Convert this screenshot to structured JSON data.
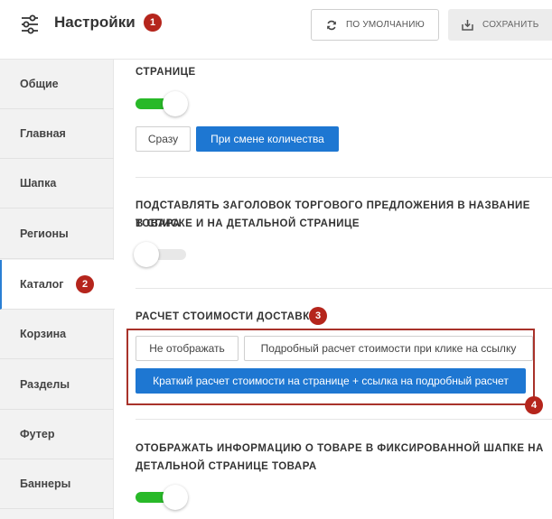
{
  "header": {
    "title": "Настройки",
    "badge": "1",
    "default_label": "ПО УМОЛЧАНИЮ",
    "save_label": "СОХРАНИТЬ"
  },
  "sidebar": {
    "items": [
      {
        "label": "Общие"
      },
      {
        "label": "Главная"
      },
      {
        "label": "Шапка"
      },
      {
        "label": "Регионы"
      },
      {
        "label": "Каталог"
      },
      {
        "label": "Корзина"
      },
      {
        "label": "Разделы"
      },
      {
        "label": "Футер"
      },
      {
        "label": "Баннеры"
      }
    ],
    "active_index": 4,
    "badge": "2"
  },
  "main": {
    "section1": {
      "title_tail": "СТРАНИЦЕ",
      "toggle": "on",
      "options": [
        "Сразу",
        "При смене количества"
      ],
      "selected": "При смене количества"
    },
    "section2": {
      "title_line1": "ПОДСТАВЛЯТЬ ЗАГОЛОВОК ТОРГОВОГО ПРЕДЛОЖЕНИЯ В НАЗВАНИЕ ТОВАРА",
      "title_line2": "В СПИСКЕ И НА ДЕТАЛЬНОЙ СТРАНИЦЕ",
      "toggle": "off"
    },
    "section3": {
      "title": "РАСЧЕТ СТОИМОСТИ ДОСТАВКИ",
      "badge_title": "3",
      "badge_box": "4",
      "options": [
        "Не отображать",
        "Подробный расчет стоимости при клике на ссылку",
        "Краткий расчет стоимости на странице + ссылка на подробный расчет"
      ],
      "selected": "Краткий расчет стоимости на странице + ссылка на подробный расчет"
    },
    "section4": {
      "title_line1": "ОТОБРАЖАТЬ ИНФОРМАЦИЮ О ТОВАРЕ В ФИКСИРОВАННОЙ ШАПКЕ НА",
      "title_line2": "ДЕТАЛЬНОЙ СТРАНИЦЕ ТОВАРА",
      "toggle": "on"
    }
  },
  "colors": {
    "accent": "#1e77d2",
    "toggle_on": "#28b928",
    "badge": "#b5251c",
    "highlight_border": "#a8322a"
  },
  "icons": {
    "settings": "sliders-icon",
    "default": "refresh-icon",
    "save": "download-icon"
  }
}
